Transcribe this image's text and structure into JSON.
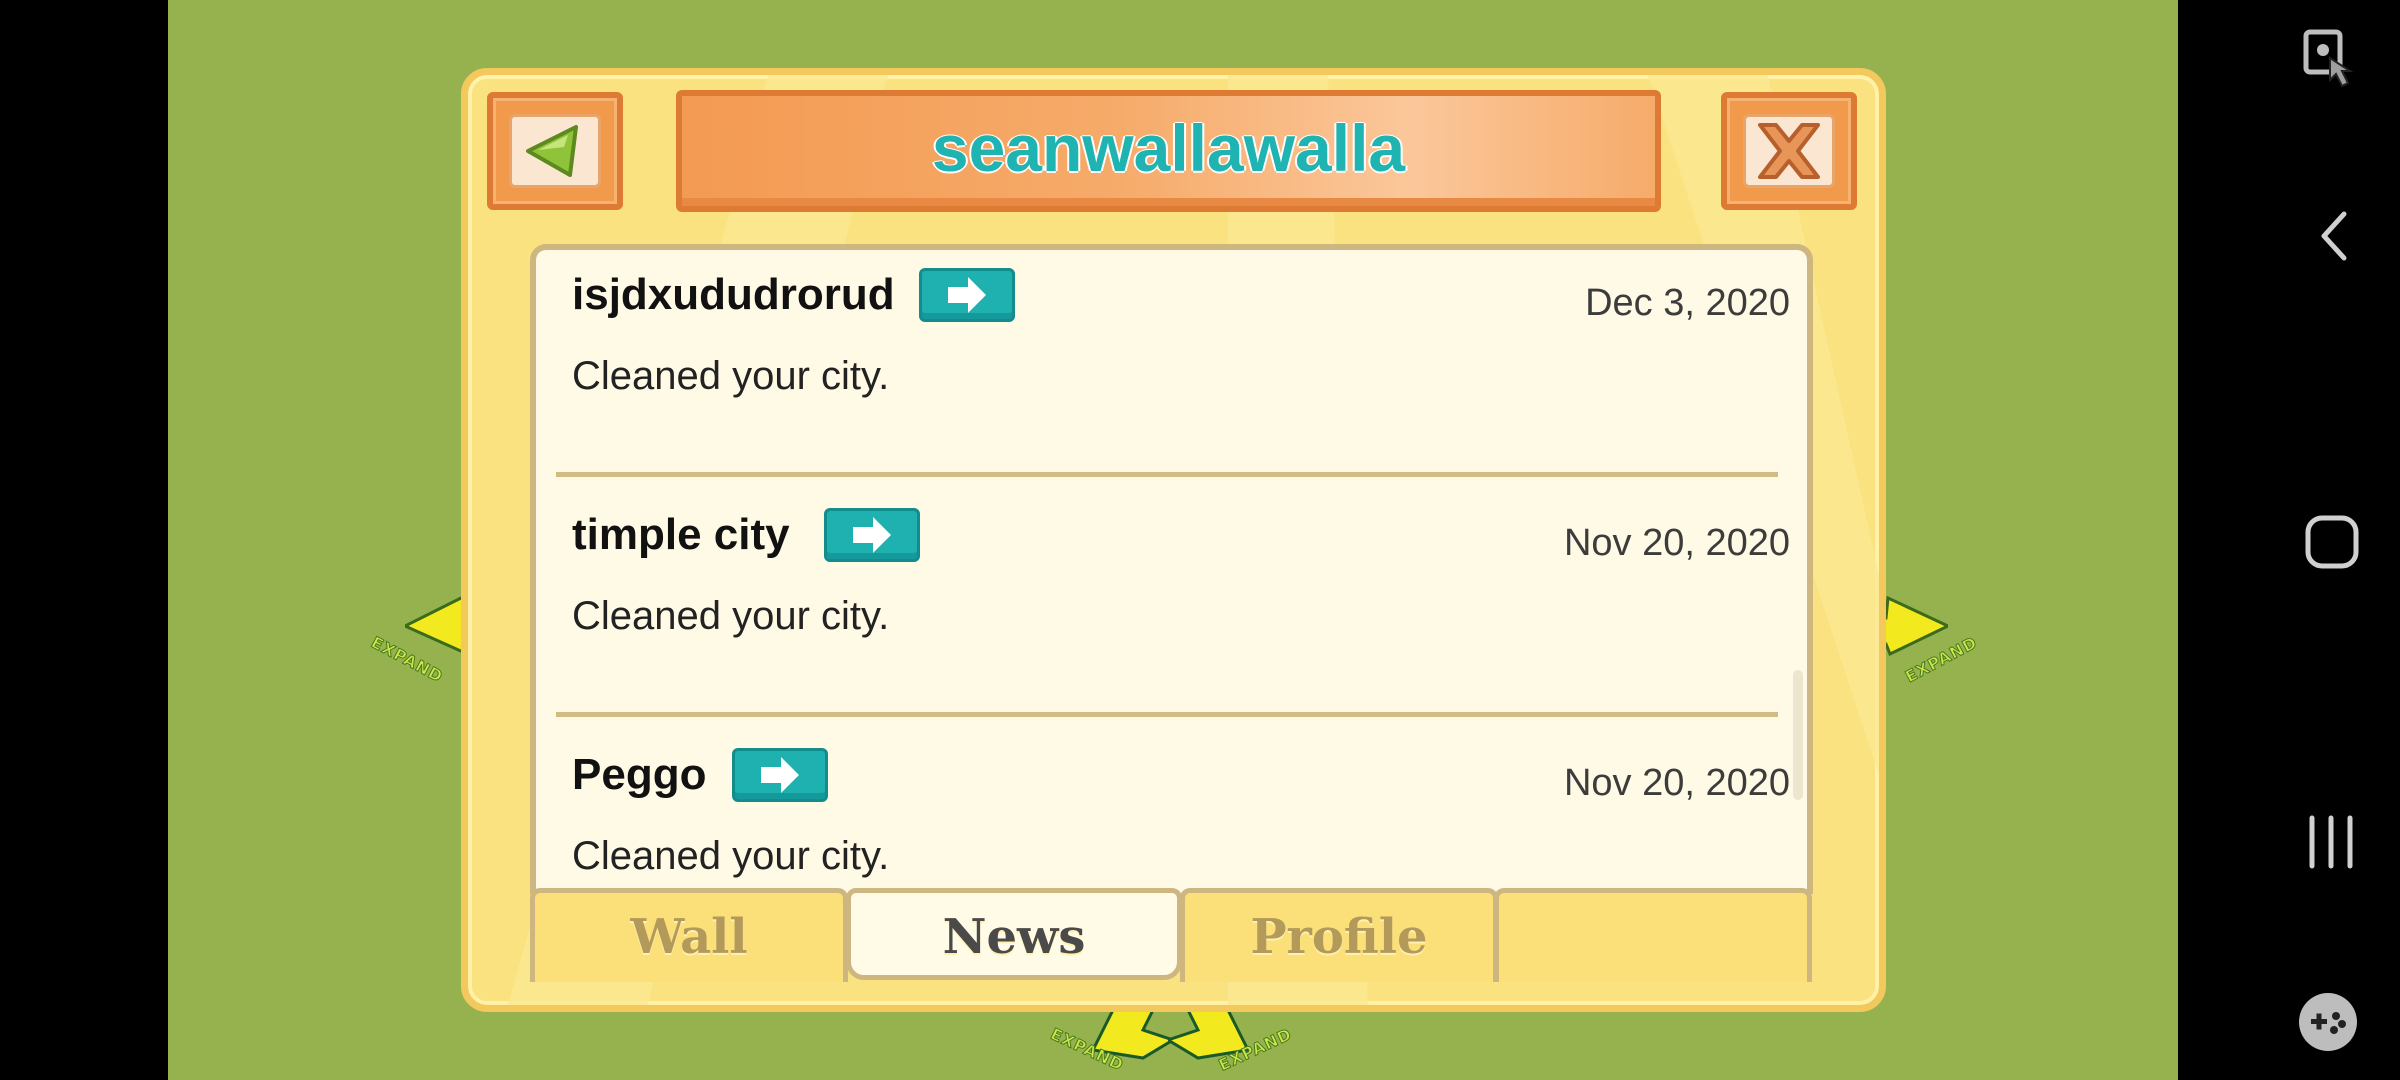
{
  "dialog": {
    "title": "seanwallawalla",
    "back_icon": "triangle-left-icon",
    "close_icon": "x-icon"
  },
  "news": {
    "entries": [
      {
        "name": "isjdxududrorud",
        "date": "Dec 3, 2020",
        "message": "Cleaned your city."
      },
      {
        "name": "timple city",
        "date": "Nov 20, 2020",
        "message": "Cleaned your city."
      },
      {
        "name": "Peggo",
        "date": "Nov 20, 2020",
        "message": "Cleaned your city."
      }
    ]
  },
  "tabs": [
    {
      "label": "Wall"
    },
    {
      "label": "News",
      "active": true
    },
    {
      "label": "Profile"
    },
    {
      "label": ""
    }
  ],
  "expand_labels": [
    "EXPAND",
    "EXPAND",
    "EXPAND",
    "EXPAND"
  ],
  "nav": {
    "icons": [
      "screen-lock-icon",
      "back-chevron-icon",
      "home-icon",
      "recents-icon",
      "game-controller-icon"
    ]
  },
  "colors": {
    "background_green": "#95b24f",
    "title_teal": "#1fb3b1",
    "banner_orange": "#f39a53",
    "panel_cream": "#fefae5"
  }
}
